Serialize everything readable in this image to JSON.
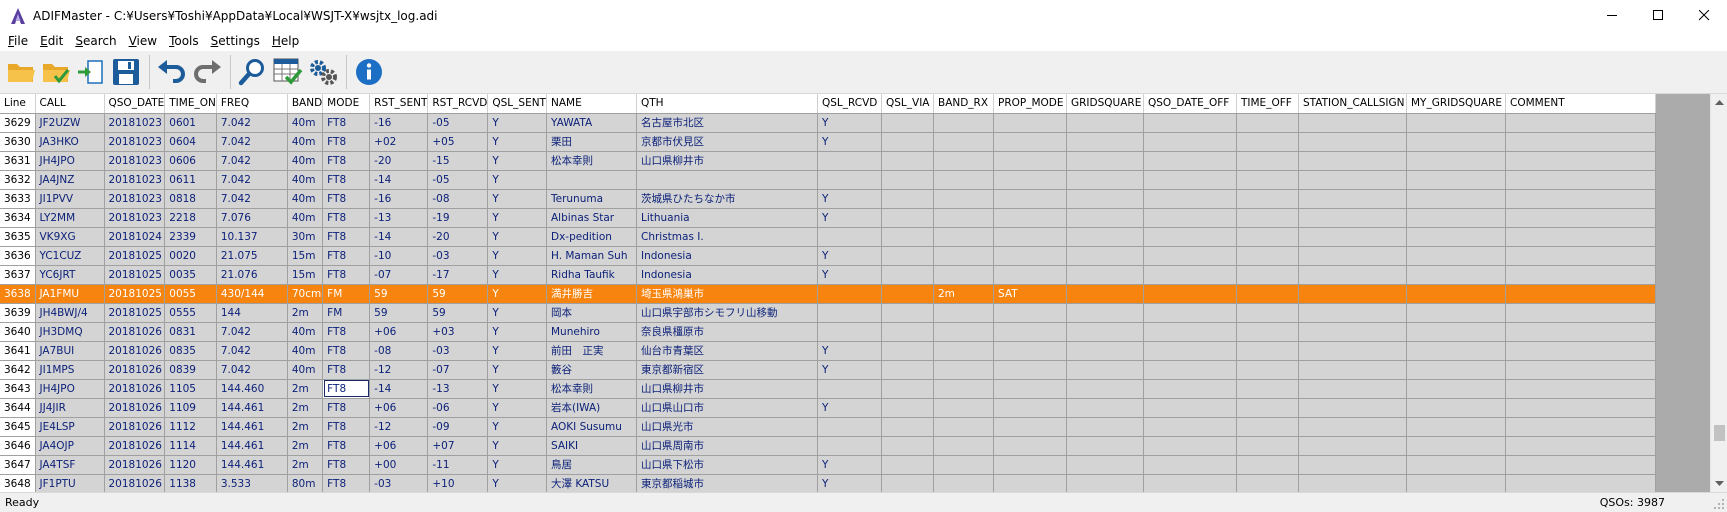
{
  "window": {
    "title": "ADIFMaster - C:¥Users¥Toshi¥AppData¥Local¥WSJT-X¥wsjtx_log.adi"
  },
  "menu": [
    {
      "label": "File",
      "accel": "F",
      "rest": "ile"
    },
    {
      "label": "Edit",
      "accel": "E",
      "rest": "dit"
    },
    {
      "label": "Search",
      "accel": "S",
      "rest": "earch"
    },
    {
      "label": "View",
      "accel": "V",
      "rest": "iew"
    },
    {
      "label": "Tools",
      "accel": "T",
      "rest": "ools"
    },
    {
      "label": "Settings",
      "accel": "S",
      "rest": "ettings"
    },
    {
      "label": "Help",
      "accel": "H",
      "rest": "elp"
    }
  ],
  "toolbar": {
    "buttons": [
      "open-folder-icon",
      "open-verified-icon",
      "import-icon",
      "save-icon",
      "undo-icon",
      "redo-icon",
      "search-icon",
      "table-check-icon",
      "settings-gears-icon",
      "info-icon"
    ]
  },
  "grid": {
    "columns": [
      "Line",
      "CALL",
      "QSO_DATE",
      "TIME_ON",
      "FREQ",
      "BAND",
      "MODE",
      "RST_SENT",
      "RST_RCVD",
      "QSL_SENT",
      "NAME",
      "QTH",
      "QSL_RCVD",
      "QSL_VIA",
      "BAND_RX",
      "PROP_MODE",
      "GRIDSQUARE",
      "QSO_DATE_OFF",
      "TIME_OFF",
      "STATION_CALLSIGN",
      "MY_GRIDSQUARE",
      "COMMENT"
    ],
    "rows": [
      [
        "3629",
        "JF2UZW",
        "20181023",
        "0601",
        "7.042",
        "40m",
        "FT8",
        "-16",
        "-05",
        "Y",
        "YAWATA",
        "名古屋市北区",
        "Y",
        "",
        "",
        "",
        "",
        "",
        "",
        "",
        "",
        ""
      ],
      [
        "3630",
        "JA3HKO",
        "20181023",
        "0604",
        "7.042",
        "40m",
        "FT8",
        "+02",
        "+05",
        "Y",
        "栗田",
        "京都市伏見区",
        "Y",
        "",
        "",
        "",
        "",
        "",
        "",
        "",
        "",
        ""
      ],
      [
        "3631",
        "JH4JPO",
        "20181023",
        "0606",
        "7.042",
        "40m",
        "FT8",
        "-20",
        "-15",
        "Y",
        "松本幸則",
        "山口県柳井市",
        "",
        "",
        "",
        "",
        "",
        "",
        "",
        "",
        "",
        ""
      ],
      [
        "3632",
        "JA4JNZ",
        "20181023",
        "0611",
        "7.042",
        "40m",
        "FT8",
        "-14",
        "-05",
        "Y",
        "",
        "",
        "",
        "",
        "",
        "",
        "",
        "",
        "",
        "",
        "",
        ""
      ],
      [
        "3633",
        "JI1PVV",
        "20181023",
        "0818",
        "7.042",
        "40m",
        "FT8",
        "-16",
        "-08",
        "Y",
        "Terunuma",
        "茨城県ひたちなか市",
        "Y",
        "",
        "",
        "",
        "",
        "",
        "",
        "",
        "",
        ""
      ],
      [
        "3634",
        "LY2MM",
        "20181023",
        "2218",
        "7.076",
        "40m",
        "FT8",
        "-13",
        "-19",
        "Y",
        "Albinas Star",
        "Lithuania",
        "Y",
        "",
        "",
        "",
        "",
        "",
        "",
        "",
        "",
        ""
      ],
      [
        "3635",
        "VK9XG",
        "20181024",
        "2339",
        "10.137",
        "30m",
        "FT8",
        "-14",
        "-20",
        "Y",
        "Dx-pedition",
        "Christmas I.",
        "",
        "",
        "",
        "",
        "",
        "",
        "",
        "",
        "",
        ""
      ],
      [
        "3636",
        "YC1CUZ",
        "20181025",
        "0020",
        "21.075",
        "15m",
        "FT8",
        "-10",
        "-03",
        "Y",
        "H. Maman Suh",
        "Indonesia",
        "Y",
        "",
        "",
        "",
        "",
        "",
        "",
        "",
        "",
        ""
      ],
      [
        "3637",
        "YC6JRT",
        "20181025",
        "0035",
        "21.076",
        "15m",
        "FT8",
        "-07",
        "-17",
        "Y",
        "Ridha Taufik",
        "Indonesia",
        "Y",
        "",
        "",
        "",
        "",
        "",
        "",
        "",
        "",
        ""
      ],
      [
        "3638",
        "JA1FMU",
        "20181025",
        "0055",
        "430/144",
        "70cm",
        "FM",
        "59",
        "59",
        "Y",
        "満井勝吉",
        "埼玉県鴻巣市",
        "",
        "",
        "2m",
        "SAT",
        "",
        "",
        "",
        "",
        "",
        ""
      ],
      [
        "3639",
        "JH4BWJ/4",
        "20181025",
        "0555",
        "144",
        "2m",
        "FM",
        "59",
        "59",
        "Y",
        "岡本",
        "山口県宇部市シモフリ山移動",
        "",
        "",
        "",
        "",
        "",
        "",
        "",
        "",
        "",
        ""
      ],
      [
        "3640",
        "JH3DMQ",
        "20181026",
        "0831",
        "7.042",
        "40m",
        "FT8",
        "+06",
        "+03",
        "Y",
        "Munehiro",
        "奈良県橿原市",
        "",
        "",
        "",
        "",
        "",
        "",
        "",
        "",
        "",
        ""
      ],
      [
        "3641",
        "JA7BUI",
        "20181026",
        "0835",
        "7.042",
        "40m",
        "FT8",
        "-08",
        "-03",
        "Y",
        "前田　正実",
        "仙台市青葉区",
        "Y",
        "",
        "",
        "",
        "",
        "",
        "",
        "",
        "",
        ""
      ],
      [
        "3642",
        "JI1MPS",
        "20181026",
        "0839",
        "7.042",
        "40m",
        "FT8",
        "-12",
        "-07",
        "Y",
        "籔谷",
        "東京都新宿区",
        "Y",
        "",
        "",
        "",
        "",
        "",
        "",
        "",
        "",
        ""
      ],
      [
        "3643",
        "JH4JPO",
        "20181026",
        "1105",
        "144.460",
        "2m",
        "FT8",
        "-14",
        "-13",
        "Y",
        "松本幸則",
        "山口県柳井市",
        "",
        "",
        "",
        "",
        "",
        "",
        "",
        "",
        "",
        ""
      ],
      [
        "3644",
        "JJ4JIR",
        "20181026",
        "1109",
        "144.461",
        "2m",
        "FT8",
        "+06",
        "-06",
        "Y",
        "岩本(IWA)",
        "山口県山口市",
        "Y",
        "",
        "",
        "",
        "",
        "",
        "",
        "",
        "",
        ""
      ],
      [
        "3645",
        "JE4LSP",
        "20181026",
        "1112",
        "144.461",
        "2m",
        "FT8",
        "-12",
        "-09",
        "Y",
        "AOKI Susumu",
        "山口県光市",
        "",
        "",
        "",
        "",
        "",
        "",
        "",
        "",
        "",
        ""
      ],
      [
        "3646",
        "JA4OJP",
        "20181026",
        "1114",
        "144.461",
        "2m",
        "FT8",
        "+06",
        "+07",
        "Y",
        "SAIKI",
        "山口県周南市",
        "",
        "",
        "",
        "",
        "",
        "",
        "",
        "",
        "",
        ""
      ],
      [
        "3647",
        "JA4TSF",
        "20181026",
        "1120",
        "144.461",
        "2m",
        "FT8",
        "+00",
        "-11",
        "Y",
        "鳥居",
        "山口県下松市",
        "Y",
        "",
        "",
        "",
        "",
        "",
        "",
        "",
        "",
        ""
      ],
      [
        "3648",
        "JF1PTU",
        "20181026",
        "1138",
        "3.533",
        "80m",
        "FT8",
        "-03",
        "+10",
        "Y",
        "大澤 KATSU",
        "東京都稲城市",
        "Y",
        "",
        "",
        "",
        "",
        "",
        "",
        "",
        "",
        ""
      ]
    ],
    "selected_row_index": 9,
    "focused_cell": {
      "row": 14,
      "col": 6
    }
  },
  "status": {
    "left": "Ready",
    "right": "QSOs: 3987"
  },
  "colors": {
    "selection": "#f7840e",
    "cell_bg": "#d4d4d4",
    "cell_text": "#0a1f78"
  }
}
